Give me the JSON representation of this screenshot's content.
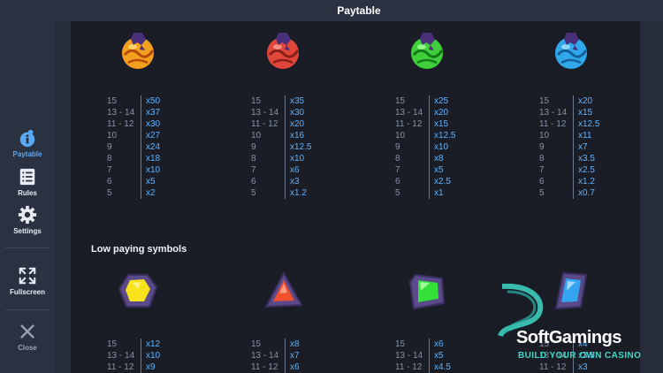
{
  "header": {
    "title": "Paytable"
  },
  "sidebar": {
    "items": [
      {
        "label": "Paytable",
        "icon": "info-icon",
        "active": true
      },
      {
        "label": "Rules",
        "icon": "list-icon",
        "active": false
      },
      {
        "label": "Settings",
        "icon": "gear-icon",
        "active": false
      },
      {
        "label": "Fullscreen",
        "icon": "fullscreen-icon",
        "active": false
      },
      {
        "label": "Close",
        "icon": "close-icon",
        "active": false
      }
    ]
  },
  "high_symbols": [
    {
      "icon": "orange-orb-icon",
      "color": "#f2a01e",
      "payouts": [
        [
          "15",
          "x50"
        ],
        [
          "13 - 14",
          "x37"
        ],
        [
          "11 - 12",
          "x30"
        ],
        [
          "10",
          "x27"
        ],
        [
          "9",
          "x24"
        ],
        [
          "8",
          "x18"
        ],
        [
          "7",
          "x10"
        ],
        [
          "6",
          "x5"
        ],
        [
          "5",
          "x2"
        ]
      ]
    },
    {
      "icon": "red-orb-icon",
      "color": "#e0463a",
      "payouts": [
        [
          "15",
          "x35"
        ],
        [
          "13 - 14",
          "x30"
        ],
        [
          "11 - 12",
          "x20"
        ],
        [
          "10",
          "x16"
        ],
        [
          "9",
          "x12.5"
        ],
        [
          "8",
          "x10"
        ],
        [
          "7",
          "x6"
        ],
        [
          "6",
          "x3"
        ],
        [
          "5",
          "x1.2"
        ]
      ]
    },
    {
      "icon": "green-orb-icon",
      "color": "#3fcf3a",
      "payouts": [
        [
          "15",
          "x25"
        ],
        [
          "13 - 14",
          "x20"
        ],
        [
          "11 - 12",
          "x15"
        ],
        [
          "10",
          "x12.5"
        ],
        [
          "9",
          "x10"
        ],
        [
          "8",
          "x8"
        ],
        [
          "7",
          "x5"
        ],
        [
          "6",
          "x2.5"
        ],
        [
          "5",
          "x1"
        ]
      ]
    },
    {
      "icon": "blue-orb-icon",
      "color": "#2fa8ec",
      "payouts": [
        [
          "15",
          "x20"
        ],
        [
          "13 - 14",
          "x15"
        ],
        [
          "11 - 12",
          "x12.5"
        ],
        [
          "10",
          "x11"
        ],
        [
          "9",
          "x7"
        ],
        [
          "8",
          "x3.5"
        ],
        [
          "7",
          "x2.5"
        ],
        [
          "6",
          "x1.2"
        ],
        [
          "5",
          "x0.7"
        ]
      ]
    }
  ],
  "low_section": {
    "title": "Low paying symbols"
  },
  "low_symbols": [
    {
      "icon": "yellow-gem-icon",
      "color": "#f7e21b",
      "payouts": [
        [
          "15",
          "x12"
        ],
        [
          "13 - 14",
          "x10"
        ],
        [
          "11 - 12",
          "x9"
        ]
      ]
    },
    {
      "icon": "red-gem-icon",
      "color": "#f0502e",
      "payouts": [
        [
          "15",
          "x8"
        ],
        [
          "13 - 14",
          "x7"
        ],
        [
          "11 - 12",
          "x6"
        ]
      ]
    },
    {
      "icon": "green-gem-icon",
      "color": "#33e03a",
      "payouts": [
        [
          "15",
          "x6"
        ],
        [
          "13 - 14",
          "x5"
        ],
        [
          "11 - 12",
          "x4.5"
        ]
      ]
    },
    {
      "icon": "blue-gem-icon",
      "color": "#34a4f0",
      "payouts": [
        [
          "15",
          "x4"
        ],
        [
          "13 - 14",
          "x3.5"
        ],
        [
          "11 - 12",
          "x3"
        ]
      ]
    }
  ],
  "watermark": {
    "name": "SoftGamings",
    "tagline": "BUILD YOUR OWN CASINO"
  }
}
